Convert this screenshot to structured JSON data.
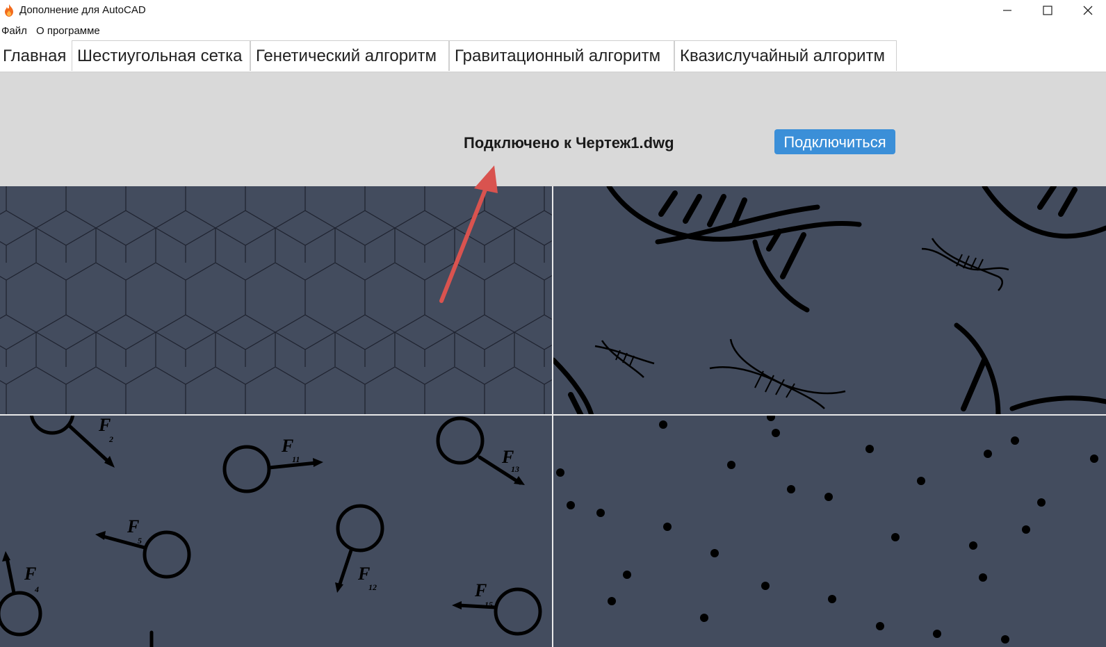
{
  "window": {
    "title": "Дополнение для AutoCAD",
    "app_icon": "flame-icon"
  },
  "menu": {
    "items": [
      "Файл",
      "О программе"
    ]
  },
  "tabs": [
    {
      "label": "Главная",
      "active": true
    },
    {
      "label": "Шестиугольная сетка",
      "active": false
    },
    {
      "label": "Генетический алгоритм",
      "active": false
    },
    {
      "label": "Гравитационный алгоритм",
      "active": false
    },
    {
      "label": "Квазислучайный алгоритм",
      "active": false
    }
  ],
  "main": {
    "status_text": "Подключено к Чертеж1.dwg",
    "connect_button": "Подключиться"
  },
  "tiles": [
    {
      "name": "hex-grid-tile",
      "image": "hexagonal-grid"
    },
    {
      "name": "genetic-tile",
      "image": "dna-helix"
    },
    {
      "name": "gravity-tile",
      "image": "circles-with-force-vectors"
    },
    {
      "name": "quasirandom-tile",
      "image": "scattered-dots"
    }
  ],
  "gravity_labels": [
    "F",
    "2",
    "11",
    "13",
    "5",
    "12",
    "4",
    "15"
  ],
  "colors": {
    "tile_bg": "#434c5e",
    "panel_bg": "#d9d9d9",
    "button": "#3b8fd8",
    "annotation_arrow": "#d9534f"
  }
}
